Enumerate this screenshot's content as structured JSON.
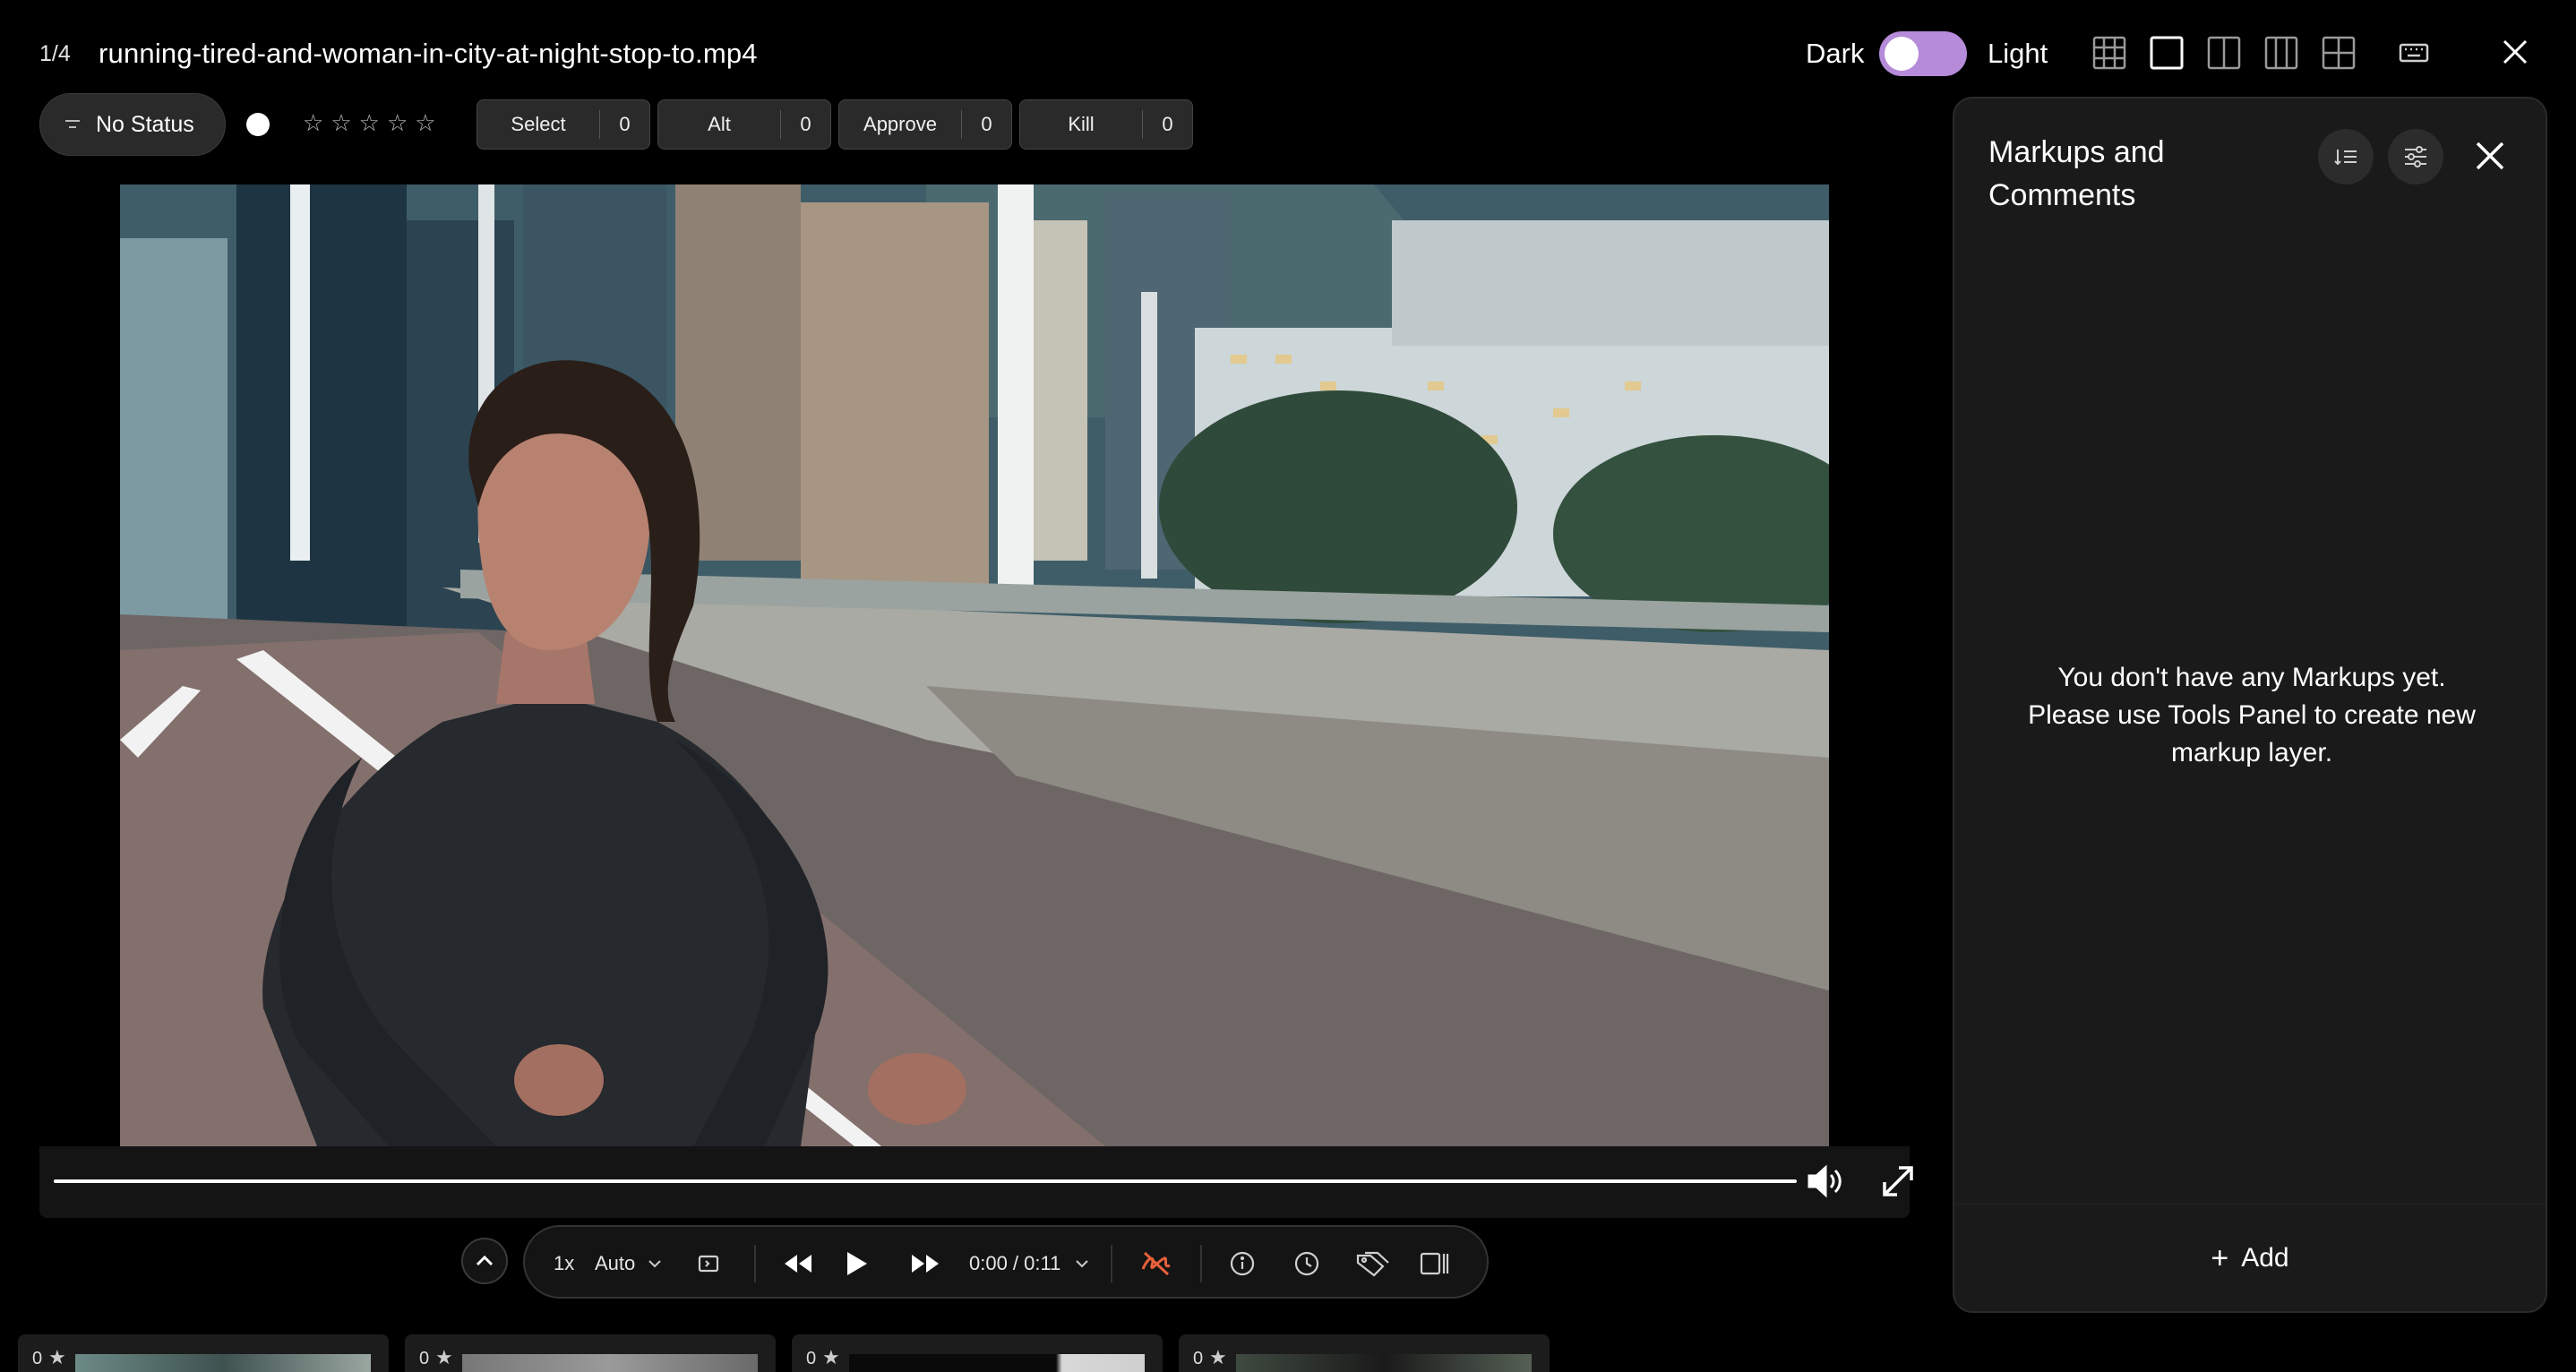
{
  "header": {
    "counter": "1/4",
    "filename": "running-tired-and-woman-in-city-at-night-stop-to.mp4",
    "theme_dark_label": "Dark",
    "theme_light_label": "Light"
  },
  "status": {
    "label": "No Status",
    "rating_max": 5,
    "votes": [
      {
        "label": "Select",
        "count": "0"
      },
      {
        "label": "Alt",
        "count": "0"
      },
      {
        "label": "Approve",
        "count": "0"
      },
      {
        "label": "Kill",
        "count": "0"
      }
    ]
  },
  "player": {
    "speed": "1x",
    "quality": "Auto",
    "time": "0:00 / 0:11",
    "progress_fraction": 0
  },
  "filmstrip": [
    {
      "count": "0"
    },
    {
      "count": "0"
    },
    {
      "count": "0"
    },
    {
      "count": "0"
    }
  ],
  "panel": {
    "title": "Markups and\nComments",
    "empty_message": "You don't have any Markups yet.\nPlease use Tools Panel to create new\nmarkup layer.",
    "add_label": "Add"
  },
  "colors": {
    "toggle": "#b68bd9",
    "background": "#000000",
    "panel": "#1a1a1a",
    "accent_scribble": "#e8603c"
  }
}
